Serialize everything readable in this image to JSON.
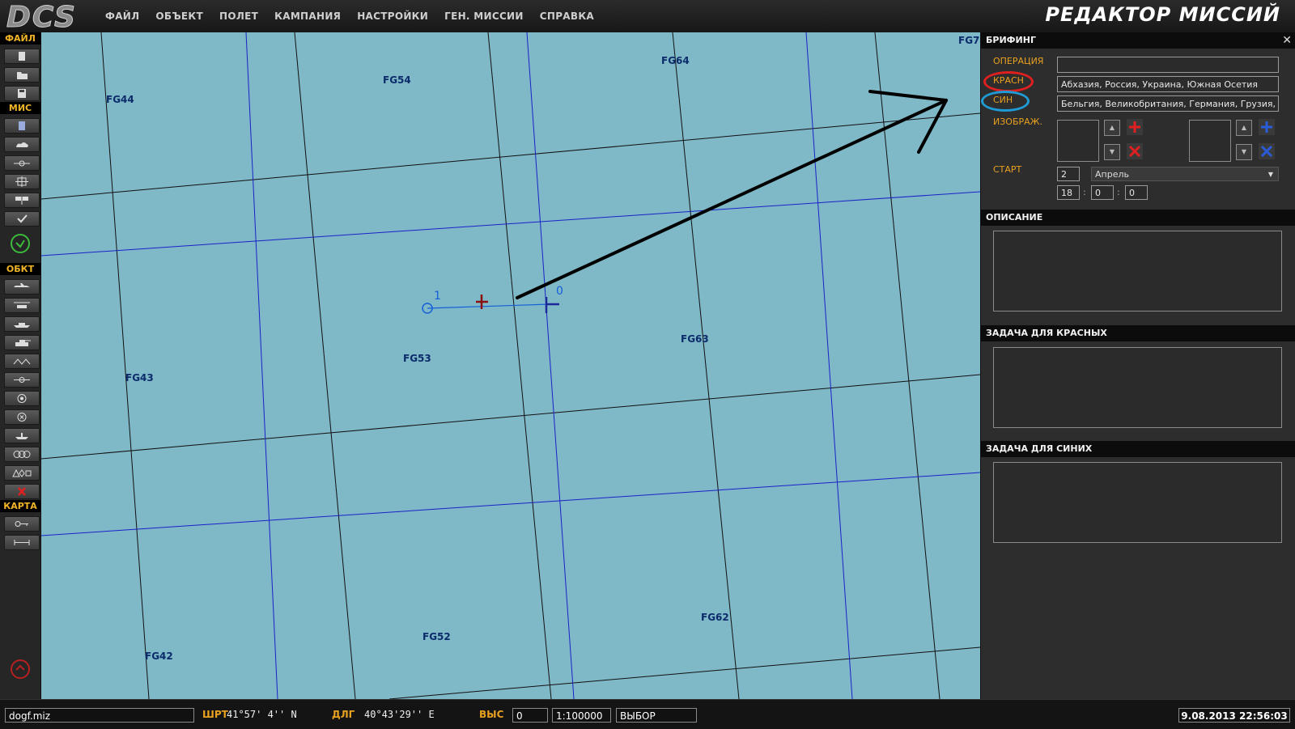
{
  "app": {
    "logo_text": "DCS",
    "title": "РЕДАКТОР МИССИЙ"
  },
  "menu": [
    "ФАЙЛ",
    "ОБЪЕКТ",
    "ПОЛЕТ",
    "КАМПАНИЯ",
    "НАСТРОЙКИ",
    "ГЕН. МИССИИ",
    "СПРАВКА"
  ],
  "toolbar": {
    "sections": {
      "file": "ФАЙЛ",
      "mission": "МИС",
      "objects": "ОБКТ",
      "map": "КАРТА"
    }
  },
  "map": {
    "grid_labels": [
      "FG44",
      "FG54",
      "FG64",
      "FG7",
      "FG43",
      "FG53",
      "FG63",
      "FG42",
      "FG52",
      "FG62"
    ],
    "waypoints": [
      "0",
      "1"
    ]
  },
  "briefing": {
    "header": "БРИФИНГ",
    "close": "✕",
    "operation_label": "ОПЕРАЦИЯ",
    "operation_value": "",
    "red_label": "КРАСН",
    "red_value": "Абхазия, Россия, Украина, Южная Осетия",
    "blue_label": "СИН",
    "blue_value": "Бельгия, Великобритания, Германия, Грузия, Д",
    "images_label": "ИЗОБРАЖ.",
    "start_label": "СТАРТ",
    "start_day": "2",
    "start_month": "Апрель",
    "start_hour": "18",
    "start_min": "0",
    "start_sec": "0",
    "time_sep": ":",
    "description_header": "ОПИСАНИЕ",
    "red_task_header": "ЗАДАЧА ДЛЯ КРАСНЫХ",
    "blue_task_header": "ЗАДАЧА ДЛЯ СИНИХ",
    "red_color": "#e02020",
    "blue_color": "#1f9bd6"
  },
  "status": {
    "filename": "dogf.miz",
    "lat_label": "ШРТ",
    "lat_value": "41°57' 4'' N",
    "lon_label": "ДЛГ",
    "lon_value": "40°43'29'' E",
    "alt_label": "ВЫС",
    "alt_value": "0",
    "scale": "1:100000",
    "mode": "ВЫБОР",
    "datetime": "9.08.2013 22:56:03"
  }
}
